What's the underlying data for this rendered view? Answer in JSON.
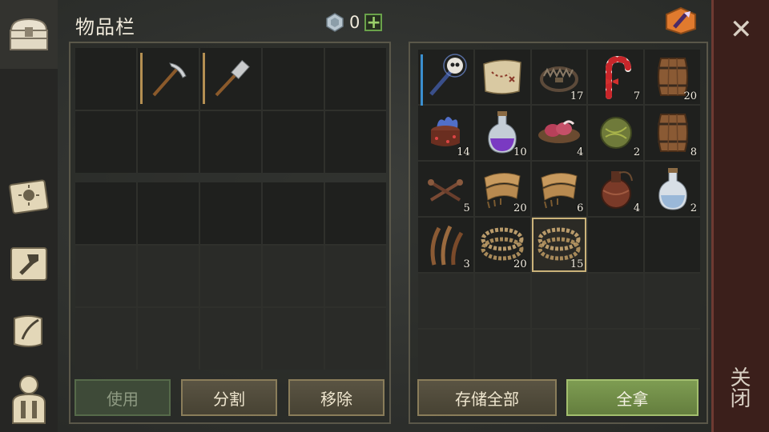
{
  "header": {
    "title": "物品栏",
    "currency_value": "0",
    "plus_label": "+"
  },
  "close": {
    "label": "关闭"
  },
  "buttons": {
    "use": "使用",
    "split": "分割",
    "remove": "移除",
    "store_all": "存储全部",
    "take_all": "全拿"
  },
  "left_inventory": {
    "top_grid": [
      {
        "icon": "empty"
      },
      {
        "icon": "pickaxe-icon"
      },
      {
        "icon": "hammer-icon"
      },
      {
        "icon": "empty"
      },
      {
        "icon": "empty"
      },
      {
        "icon": "empty"
      },
      {
        "icon": "empty"
      },
      {
        "icon": "empty"
      },
      {
        "icon": "empty"
      },
      {
        "icon": "empty"
      }
    ]
  },
  "storage": {
    "items": [
      {
        "icon": "skull-staff-icon",
        "qty": ""
      },
      {
        "icon": "treasure-map-icon",
        "qty": ""
      },
      {
        "icon": "bear-trap-icon",
        "qty": "17"
      },
      {
        "icon": "candy-cane-icon",
        "qty": "7"
      },
      {
        "icon": "barrel-icon",
        "qty": "20"
      },
      {
        "icon": "cursed-cake-icon",
        "qty": "14"
      },
      {
        "icon": "purple-potion-icon",
        "qty": "10"
      },
      {
        "icon": "meat-bowl-icon",
        "qty": "4"
      },
      {
        "icon": "herb-ball-icon",
        "qty": "2"
      },
      {
        "icon": "barrel-icon",
        "qty": "8"
      },
      {
        "icon": "nails-icon",
        "qty": "5"
      },
      {
        "icon": "cloth-icon",
        "qty": "20"
      },
      {
        "icon": "cloth-icon",
        "qty": "6"
      },
      {
        "icon": "flask-icon",
        "qty": "4"
      },
      {
        "icon": "water-bottle-icon",
        "qty": "2"
      },
      {
        "icon": "fiber-icon",
        "qty": "3"
      },
      {
        "icon": "rope-icon",
        "qty": "20"
      },
      {
        "icon": "rope-icon",
        "qty": "15"
      }
    ]
  },
  "colors": {
    "accent_green": "#6aa24a",
    "selected_border": "#cbb37a",
    "close_panel": "#3b1f1b"
  }
}
